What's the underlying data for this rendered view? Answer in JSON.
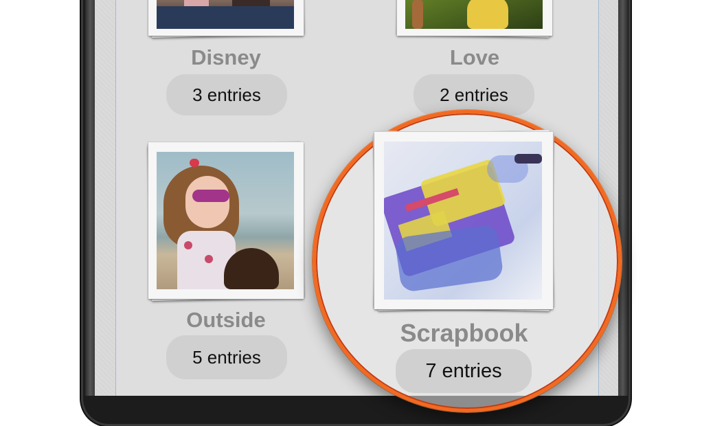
{
  "albums": [
    {
      "id": "disney",
      "title": "Disney",
      "count": "3 entries"
    },
    {
      "id": "love",
      "title": "Love",
      "count": "2 entries"
    },
    {
      "id": "outside",
      "title": "Outside",
      "count": "5 entries"
    },
    {
      "id": "scrapbook",
      "title": "Scrapbook",
      "count": "7 entries"
    }
  ],
  "highlight": {
    "color": "#f26a21"
  },
  "icons": {
    "disney_thumb": "photo-thumbnail-icon",
    "love_thumb": "photo-thumbnail-icon",
    "outside_thumb": "photo-thumbnail-icon",
    "scrapbook_thumb": "photo-thumbnail-icon"
  }
}
